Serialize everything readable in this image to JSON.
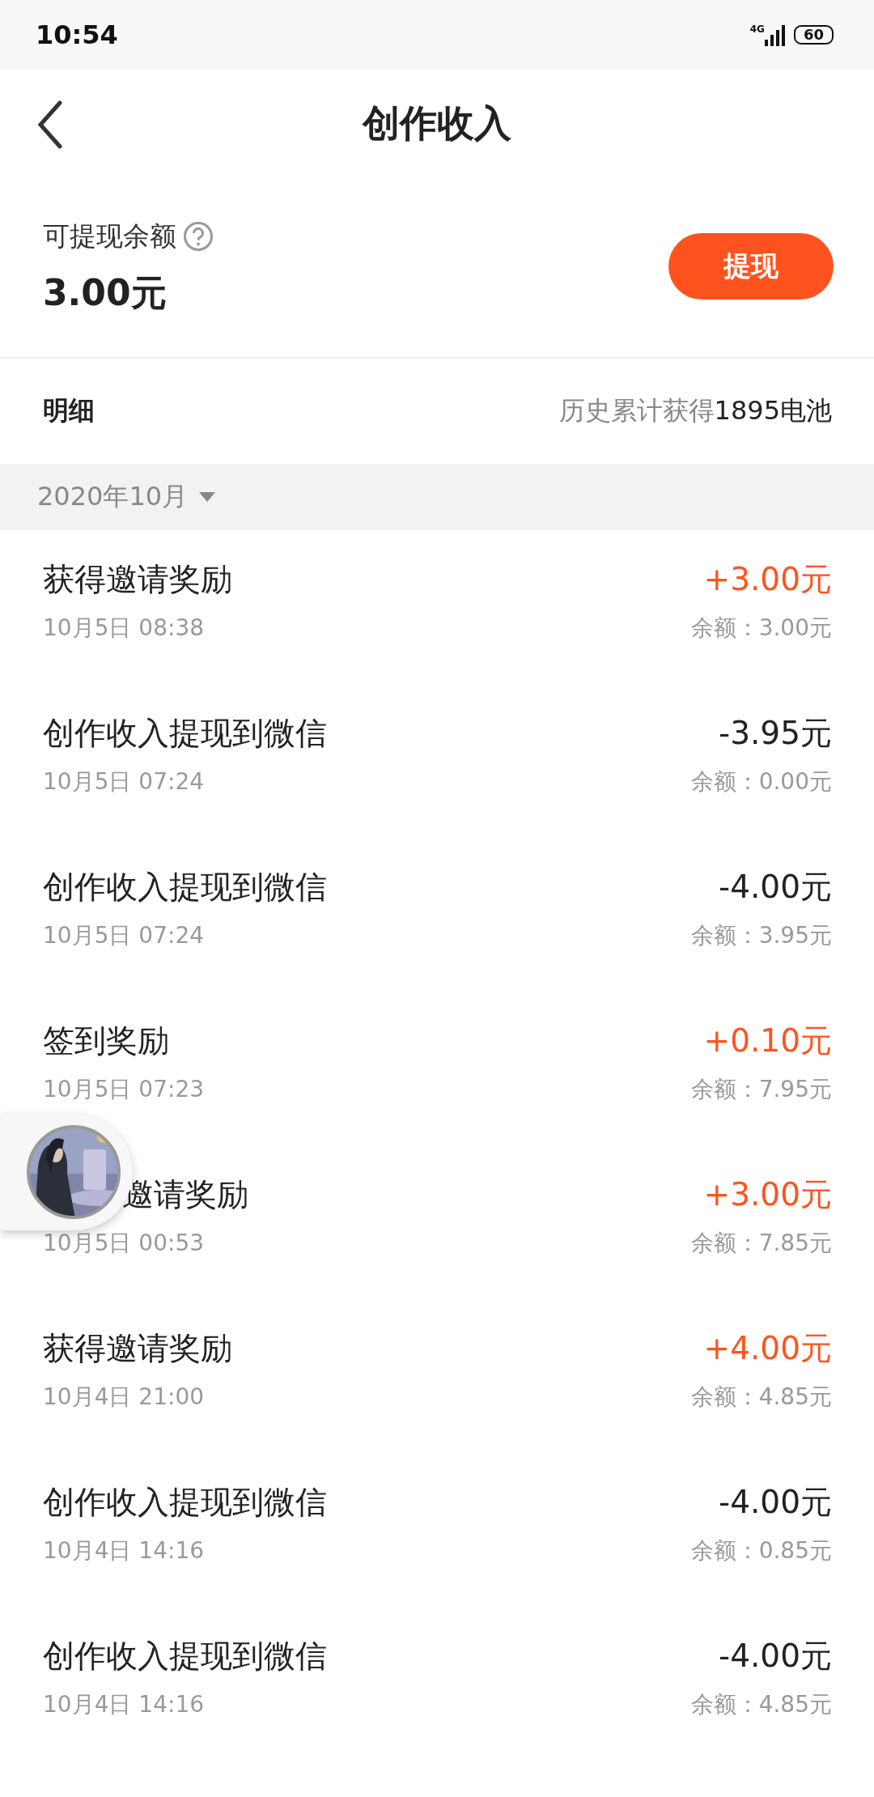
{
  "status_bar": {
    "time": "10:54",
    "network": "4G",
    "battery": "60"
  },
  "header": {
    "title": "创作收入"
  },
  "balance": {
    "label": "可提现余额",
    "amount": "3.00元",
    "button": "提现"
  },
  "summary": {
    "label": "明细",
    "total_prefix": "历史累计获得",
    "total_value": "1895电池"
  },
  "month_filter": {
    "label": "2020年10月"
  },
  "records": [
    {
      "title": "获得邀请奖励",
      "date": "10月5日 08:38",
      "amount": "+3.00元",
      "income": true,
      "balance": "余额：3.00元"
    },
    {
      "title": "创作收入提现到微信",
      "date": "10月5日 07:24",
      "amount": "-3.95元",
      "income": false,
      "balance": "余额：0.00元"
    },
    {
      "title": "创作收入提现到微信",
      "date": "10月5日 07:24",
      "amount": "-4.00元",
      "income": false,
      "balance": "余额：3.95元"
    },
    {
      "title": "签到奖励",
      "date": "10月5日 07:23",
      "amount": "+0.10元",
      "income": true,
      "balance": "余额：7.95元"
    },
    {
      "title": "邀请奖励",
      "date": "10月5日 00:53",
      "amount": "+3.00元",
      "income": true,
      "balance": "余额：7.85元",
      "obscured": true
    },
    {
      "title": "获得邀请奖励",
      "date": "10月4日 21:00",
      "amount": "+4.00元",
      "income": true,
      "balance": "余额：4.85元"
    },
    {
      "title": "创作收入提现到微信",
      "date": "10月4日 14:16",
      "amount": "-4.00元",
      "income": false,
      "balance": "余额：0.85元"
    },
    {
      "title": "创作收入提现到微信",
      "date": "10月4日 14:16",
      "amount": "-4.00元",
      "income": false,
      "balance": "余额：4.85元"
    }
  ]
}
